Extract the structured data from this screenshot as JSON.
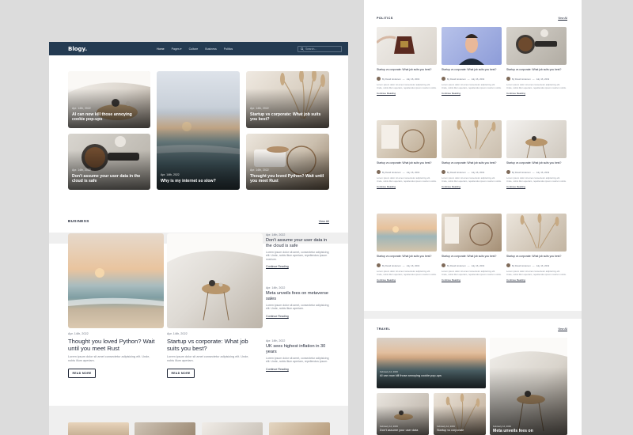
{
  "left": {
    "nav": {
      "logo": "Blogy.",
      "links": [
        "Home",
        "Pages",
        "Culture",
        "Business",
        "Politics"
      ],
      "pages_caret": "▾",
      "search_placeholder": "Search..."
    },
    "hero": [
      {
        "date": "Apr. 14th, 2022",
        "title": "AI can now kill those annoying cookie pop-ups"
      },
      {
        "date": "Apr. 14th, 2022",
        "title": "Why is my internet so slow?"
      },
      {
        "date": "Apr. 14th, 2022",
        "title": "Startup vs corporate: What job suits you best?"
      },
      {
        "date": "Apr. 14th, 2022",
        "title": "Don't assume your user data in the cloud is safe"
      },
      {
        "date": "Apr. 14th, 2022",
        "title": "Thought you loved Python? Wait until you meet Rust"
      }
    ],
    "business": {
      "heading": "BUSINESS",
      "view_all": "View All",
      "main": [
        {
          "date": "Apr. 14th, 2022",
          "title": "Thought you loved Python? Wait until you meet Rust",
          "excerpt": "Lorem ipsum dolor sit amet consectetur adipisicing elit. Unde, nobis illum aperiam.",
          "button": "READ MORE"
        },
        {
          "date": "Apr. 14th, 2022",
          "title": "Startup vs corporate: What job suits you best?",
          "excerpt": "Lorem ipsum dolor sit amet consectetur adipisicing elit. Unde, nobis illum aperiam.",
          "button": "READ MORE"
        }
      ],
      "side": [
        {
          "date": "Apr. 14th, 2022",
          "title": "Don't assume your user data in the cloud is safe",
          "excerpt": "Lorem ipsum dolor sit amet, consectetur adipisicing elit. Unde, nobis illum aperiam, repellendus ipsum nostrum.",
          "link": "Continue Reading"
        },
        {
          "date": "Apr. 14th, 2022",
          "title": "Meta unveils fees on metaverse sales",
          "excerpt": "Lorem ipsum dolor sit amet, consectetur adipisicing elit. Unde, nobis illum aperiam.",
          "link": "Continue Reading"
        },
        {
          "date": "Apr. 14th, 2022",
          "title": "UK sees highest inflation in 30 years",
          "excerpt": "Lorem ipsum dolor sit amet, consectetur adipisicing elit. Unde, nobis illum aperiam, repellendus ipsum.",
          "link": "Continue Reading"
        }
      ]
    }
  },
  "right": {
    "politics": {
      "heading": "POLITICS",
      "view_all": "View All",
      "cards": [
        {
          "title": "Startup vs corporate: What job suits you best?",
          "author": "By David Anderson",
          "date": "July 16, 2019",
          "excerpt": "Lorem ipsum dolor sit amet consectetur adipisicing elit. Unde, nobis illum aperiam, repellendus ipsum nostrum nobis.",
          "link": "Continue Reading"
        },
        {
          "title": "Startup vs corporate: What job suits you best?",
          "author": "By David Anderson",
          "date": "July 16, 2019",
          "excerpt": "Lorem ipsum dolor sit amet consectetur adipisicing elit. Unde, nobis illum aperiam, repellendus ipsum nostrum nobis.",
          "link": "Continue Reading"
        },
        {
          "title": "Startup vs corporate: What job suits you best?",
          "author": "By David Anderson",
          "date": "July 16, 2019",
          "excerpt": "Lorem ipsum dolor sit amet consectetur adipisicing elit. Unde, nobis illum aperiam, repellendus ipsum nostrum nobis.",
          "link": "Continue Reading"
        },
        {
          "title": "Startup vs corporate: What job suits you best?",
          "author": "By David Anderson",
          "date": "July 16, 2019",
          "excerpt": "Lorem ipsum dolor sit amet consectetur adipisicing elit. Unde, nobis illum aperiam, repellendus ipsum nostrum nobis.",
          "link": "Continue Reading"
        },
        {
          "title": "Startup vs corporate: What job suits you best?",
          "author": "By David Anderson",
          "date": "July 16, 2019",
          "excerpt": "Lorem ipsum dolor sit amet consectetur adipisicing elit. Unde, nobis illum aperiam, repellendus ipsum nostrum nobis.",
          "link": "Continue Reading"
        },
        {
          "title": "Startup vs corporate: What job suits you best?",
          "author": "By David Anderson",
          "date": "July 16, 2019",
          "excerpt": "Lorem ipsum dolor sit amet consectetur adipisicing elit. Unde, nobis illum aperiam, repellendus ipsum nostrum nobis.",
          "link": "Continue Reading"
        },
        {
          "title": "Startup vs corporate: What job suits you best?",
          "author": "By David Anderson",
          "date": "July 16, 2019",
          "excerpt": "Lorem ipsum dolor sit amet consectetur adipisicing elit. Unde, nobis illum aperiam, repellendus ipsum nostrum nobis.",
          "link": "Continue Reading"
        },
        {
          "title": "Startup vs corporate: What job suits you best?",
          "author": "By David Anderson",
          "date": "July 16, 2019",
          "excerpt": "Lorem ipsum dolor sit amet consectetur adipisicing elit. Unde, nobis illum aperiam, repellendus ipsum nostrum nobis.",
          "link": "Continue Reading"
        },
        {
          "title": "Startup vs corporate: What job suits you best?",
          "author": "By David Anderson",
          "date": "July 16, 2019",
          "excerpt": "Lorem ipsum dolor sit amet consectetur adipisicing elit. Unde, nobis illum aperiam, repellendus ipsum nostrum nobis.",
          "link": "Continue Reading"
        }
      ]
    },
    "travel": {
      "heading": "TRAVEL",
      "view_all": "View All",
      "cards": [
        {
          "date": "February 12, 2019",
          "title": "AI can now kill those annoying cookie pop-ups"
        },
        {
          "date": "February 12, 2019",
          "title": "Meta unveils fees on"
        },
        {
          "date": "February 12, 2019",
          "title": "Don't assume your user data"
        },
        {
          "date": "February 12, 2019",
          "title": "Startup vs corporate"
        }
      ]
    }
  }
}
